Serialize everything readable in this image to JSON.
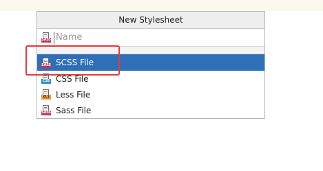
{
  "dialog": {
    "title": "New Stylesheet",
    "name_placeholder": "Name",
    "name_icon": "sass-file-icon"
  },
  "file_types": [
    {
      "label": "SCSS File",
      "icon": "scss-file-icon",
      "tag": "SASS",
      "selected": true
    },
    {
      "label": "CSS File",
      "icon": "css-file-icon",
      "tag": "CSS",
      "selected": false
    },
    {
      "label": "Less File",
      "icon": "less-file-icon",
      "tag": "{L}",
      "selected": false
    },
    {
      "label": "Sass File",
      "icon": "sass-file-icon",
      "tag": "SASS",
      "selected": false
    }
  ],
  "colors": {
    "selection": "#2f6fb8",
    "highlight_annotation": "#e23a3a",
    "sass_tag": "#c2365a",
    "css_tag": "#2a8fc9",
    "less_tag": "#e8a03a"
  }
}
